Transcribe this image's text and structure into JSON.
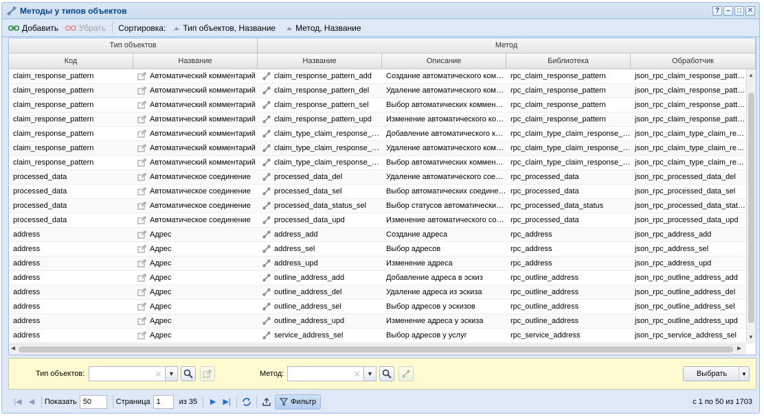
{
  "window": {
    "title": "Методы у типов объектов"
  },
  "toolbar": {
    "add_label": "Добавить",
    "remove_label": "Убрать",
    "sort_label": "Сортировка:",
    "sort1_label": "Тип объектов, Название",
    "sort2_label": "Метод, Название"
  },
  "grid": {
    "group_object_type": "Тип объектов",
    "group_method": "Метод",
    "columns": [
      "Код",
      "Название",
      "Название",
      "Описание",
      "Библиотека",
      "Обработчик"
    ],
    "rows": [
      [
        "claim_response_pattern",
        "Автоматический комментарий",
        "claim_response_pattern_add",
        "Создание автоматического комментария",
        "rpc_claim_response_pattern",
        "json_rpc_claim_response_pattern_add"
      ],
      [
        "claim_response_pattern",
        "Автоматический комментарий",
        "claim_response_pattern_del",
        "Удаление автоматического комментария",
        "rpc_claim_response_pattern",
        "json_rpc_claim_response_pattern_del"
      ],
      [
        "claim_response_pattern",
        "Автоматический комментарий",
        "claim_response_pattern_sel",
        "Выбор автоматических комментариев",
        "rpc_claim_response_pattern",
        "json_rpc_claim_response_pattern_sel"
      ],
      [
        "claim_response_pattern",
        "Автоматический комментарий",
        "claim_response_pattern_upd",
        "Изменение автоматического комментария",
        "rpc_claim_response_pattern",
        "json_rpc_claim_response_pattern_upd"
      ],
      [
        "claim_response_pattern",
        "Автоматический комментарий",
        "claim_type_claim_response_pattern_add",
        "Добавление автоматического комментария",
        "rpc_claim_type_claim_response_pattern",
        "json_rpc_claim_type_claim_response_pattern_add"
      ],
      [
        "claim_response_pattern",
        "Автоматический комментарий",
        "claim_type_claim_response_pattern_del",
        "Удаление автоматического комментария",
        "rpc_claim_type_claim_response_pattern",
        "json_rpc_claim_type_claim_response_pattern_del"
      ],
      [
        "claim_response_pattern",
        "Автоматический комментарий",
        "claim_type_claim_response_pattern_sel",
        "Выбор автоматических комментариев",
        "rpc_claim_type_claim_response_pattern",
        "json_rpc_claim_type_claim_response_pattern_sel"
      ],
      [
        "processed_data",
        "Автоматическое соединение",
        "processed_data_del",
        "Удаление автоматического соединения",
        "rpc_processed_data",
        "json_rpc_processed_data_del"
      ],
      [
        "processed_data",
        "Автоматическое соединение",
        "processed_data_sel",
        "Выбор автоматических соединений",
        "rpc_processed_data",
        "json_rpc_processed_data_sel"
      ],
      [
        "processed_data",
        "Автоматическое соединение",
        "processed_data_status_sel",
        "Выбор статусов автоматических соединений",
        "rpc_processed_data_status",
        "json_rpc_processed_data_status_sel"
      ],
      [
        "processed_data",
        "Автоматическое соединение",
        "processed_data_upd",
        "Изменение автоматического соединения",
        "rpc_processed_data",
        "json_rpc_processed_data_upd"
      ],
      [
        "address",
        "Адрес",
        "address_add",
        "Создание адреса",
        "rpc_address",
        "json_rpc_address_add"
      ],
      [
        "address",
        "Адрес",
        "address_sel",
        "Выбор адресов",
        "rpc_address",
        "json_rpc_address_sel"
      ],
      [
        "address",
        "Адрес",
        "address_upd",
        "Изменение адреса",
        "rpc_address",
        "json_rpc_address_upd"
      ],
      [
        "address",
        "Адрес",
        "outline_address_add",
        "Добавление адреса в эскиз",
        "rpc_outline_address",
        "json_rpc_outline_address_add"
      ],
      [
        "address",
        "Адрес",
        "outline_address_del",
        "Удаление адреса из эскиза",
        "rpc_outline_address",
        "json_rpc_outline_address_del"
      ],
      [
        "address",
        "Адрес",
        "outline_address_sel",
        "Выбор адресов у эскизов",
        "rpc_outline_address",
        "json_rpc_outline_address_sel"
      ],
      [
        "address",
        "Адрес",
        "outline_address_upd",
        "Изменение адреса у эскиза",
        "rpc_outline_address",
        "json_rpc_outline_address_upd"
      ],
      [
        "address",
        "Адрес",
        "service_address_sel",
        "Выбор адресов у услуг",
        "rpc_service_address",
        "json_rpc_service_address_sel"
      ]
    ]
  },
  "filter": {
    "object_type_label": "Тип объектов:",
    "method_label": "Метод:",
    "select_label": "Выбрать"
  },
  "pager": {
    "show_label": "Показать",
    "page_size": "50",
    "page_label": "Страница",
    "page": "1",
    "of_pages": "из 35",
    "filter_label": "Фильтр",
    "info": "с 1 по 50 из 1703"
  }
}
